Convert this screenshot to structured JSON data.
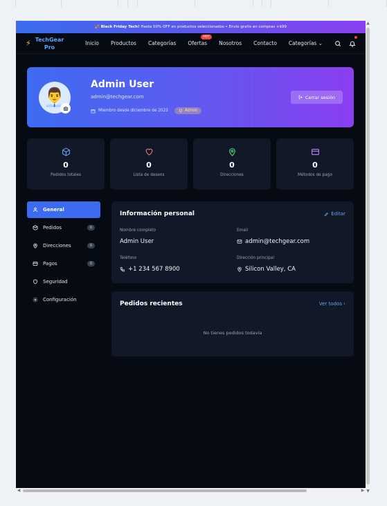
{
  "promo": {
    "emoji": "🎉",
    "bold": "Black Friday Tech!",
    "text": " Hasta 50% OFF en productos seleccionados • Envío gratis en compras +$99"
  },
  "nav": {
    "brand_line1": "TechGear",
    "brand_line2": "Pro",
    "links": [
      "Inicio",
      "Productos",
      "Categorías",
      "Ofertas",
      "Nosotros",
      "Contacto",
      "Categorías ⌄"
    ],
    "hot_badge": "HOT"
  },
  "profile": {
    "name": "Admin User",
    "email": "admin@techgear.com",
    "member_since": "Miembro desde diciembre de 2022",
    "role_badge": "Admin",
    "logout_label": "Cerrar sesión",
    "avatar_emoji": "👨‍💼"
  },
  "stats": [
    {
      "value": "0",
      "label": "Pedidos totales",
      "icon": "box-icon",
      "color": "#60a5fa"
    },
    {
      "value": "0",
      "label": "Lista de deseos",
      "icon": "heart-icon",
      "color": "#f87171"
    },
    {
      "value": "0",
      "label": "Direcciones",
      "icon": "map-pin-icon",
      "color": "#4ade80"
    },
    {
      "value": "0",
      "label": "Métodos de pago",
      "icon": "credit-card-icon",
      "color": "#c084fc"
    }
  ],
  "sidebar": {
    "items": [
      {
        "label": "General",
        "count": null,
        "active": true
      },
      {
        "label": "Pedidos",
        "count": "0"
      },
      {
        "label": "Direcciones",
        "count": "0"
      },
      {
        "label": "Pagos",
        "count": "0"
      },
      {
        "label": "Seguridad",
        "count": null
      },
      {
        "label": "Configuración",
        "count": null
      }
    ]
  },
  "info": {
    "title": "Información personal",
    "edit_label": "Editar",
    "fullname_label": "Nombre completo",
    "fullname": "Admin User",
    "email_label": "Email",
    "email": "admin@techgear.com",
    "phone_label": "Teléfono",
    "phone": "+1 234 567 8900",
    "address_label": "Dirección principal",
    "address": "Silicon Valley, CA"
  },
  "orders": {
    "title": "Pedidos recientes",
    "view_all": "Ver todos ›",
    "empty": "No tienes pedidos todavía"
  }
}
